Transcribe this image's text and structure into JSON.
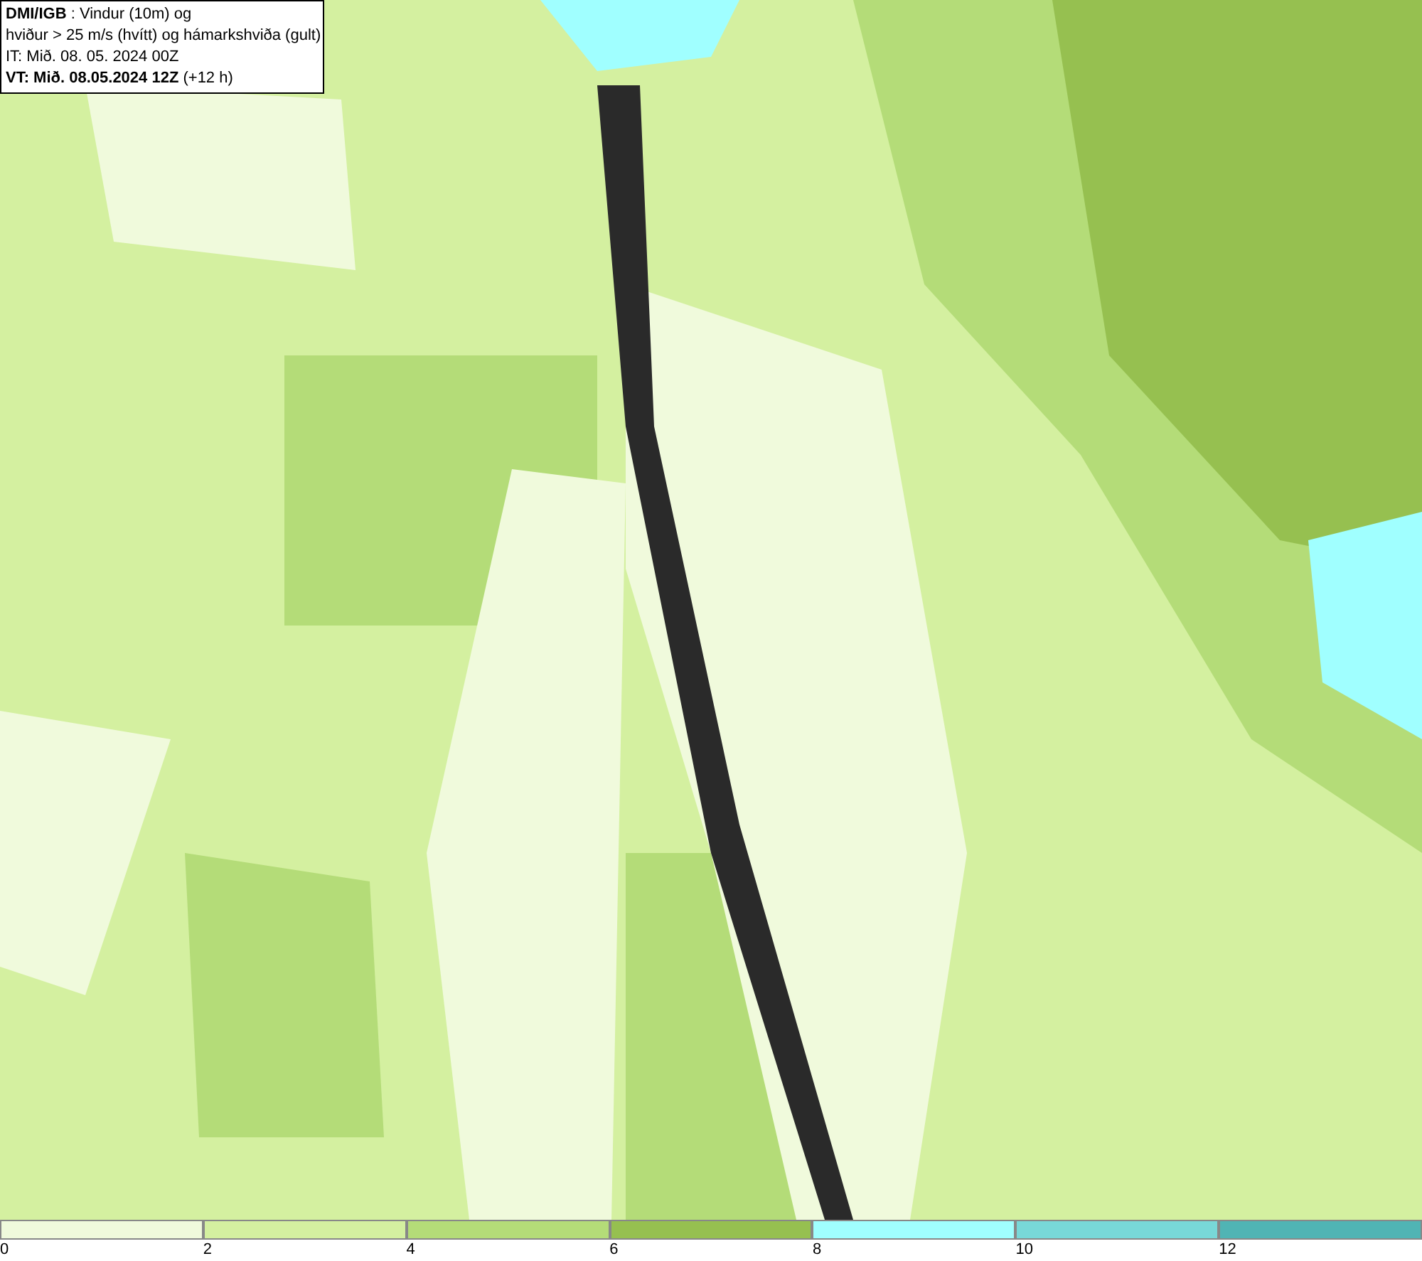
{
  "legend": {
    "lines": [
      "**DMI/IGB** : Vindur (10m) og",
      "hviður > 25 m/s (hvítt) og hámarkshviða (gult)",
      "IT: Mið. 08. 05. 2024 00Z",
      "**VT: Mið. 08.05.2024 12Z** (+12 h)"
    ]
  },
  "colorbar": [
    {
      "color": "#f0fadc",
      "label": "0"
    },
    {
      "color": "#d4f0a0",
      "label": "2"
    },
    {
      "color": "#b4dc78",
      "label": "4"
    },
    {
      "color": "#96c050",
      "label": "6"
    },
    {
      "color": "#a0ffff",
      "label": "8"
    },
    {
      "color": "#78d8d8",
      "label": "10"
    },
    {
      "color": "#50b4b4",
      "label": "12"
    }
  ]
}
